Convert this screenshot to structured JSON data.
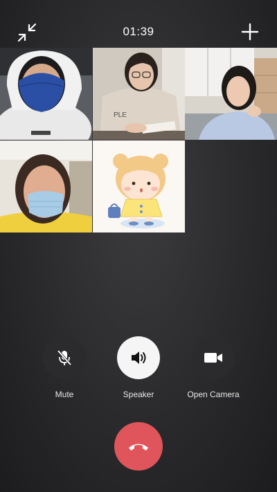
{
  "call": {
    "timer": "01:39"
  },
  "icons": {
    "minimize": "minimize-icon",
    "add": "add-participant-icon",
    "mute": "microphone-off-icon",
    "speaker": "speaker-icon",
    "camera": "video-camera-icon",
    "hangup": "hang-up-icon"
  },
  "participants": [
    {
      "tile": "participant-1",
      "kind": "video"
    },
    {
      "tile": "participant-2",
      "kind": "video"
    },
    {
      "tile": "participant-3",
      "kind": "video"
    },
    {
      "tile": "participant-4",
      "kind": "video"
    },
    {
      "tile": "participant-5",
      "kind": "avatar"
    }
  ],
  "controls": {
    "mute_label": "Mute",
    "speaker_label": "Speaker",
    "camera_label": "Open Camera"
  },
  "colors": {
    "hangup": "#e0555b",
    "speaker_active": "#f5f5f5",
    "button_dark": "#2b2b2d"
  }
}
